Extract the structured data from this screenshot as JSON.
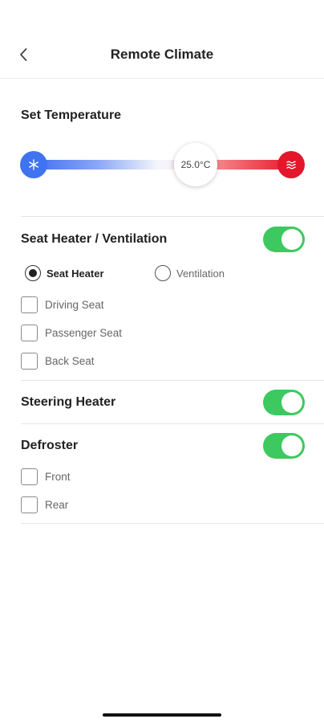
{
  "header": {
    "title": "Remote Climate"
  },
  "temperature": {
    "section_title": "Set Temperature",
    "value_label": "25.0°C",
    "level": 0.67,
    "colors": {
      "cold": "#3f73f0",
      "hot": "#e3162c"
    }
  },
  "seat": {
    "section_title": "Seat Heater / Ventilation",
    "enabled": true,
    "modes": [
      {
        "label": "Seat Heater",
        "selected": true
      },
      {
        "label": "Ventilation",
        "selected": false
      }
    ],
    "options": [
      {
        "label": "Driving Seat",
        "checked": false
      },
      {
        "label": "Passenger Seat",
        "checked": false
      },
      {
        "label": "Back Seat",
        "checked": false
      }
    ]
  },
  "steering": {
    "section_title": "Steering Heater",
    "enabled": true
  },
  "defroster": {
    "section_title": "Defroster",
    "enabled": true,
    "options": [
      {
        "label": "Front",
        "checked": false
      },
      {
        "label": "Rear",
        "checked": false
      }
    ]
  },
  "colors": {
    "toggle_on": "#3dc95f",
    "accent_text": "#222222"
  }
}
